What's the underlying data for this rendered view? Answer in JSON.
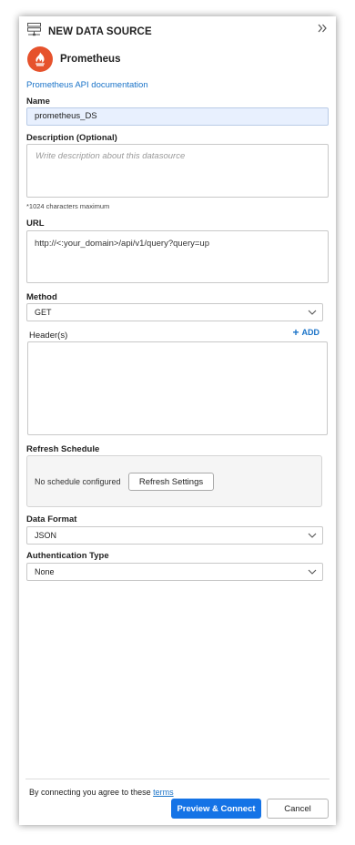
{
  "header": {
    "title": "NEW DATA SOURCE",
    "icon": "server-stack-icon",
    "collapse_icon": "double-chevron-right-icon"
  },
  "provider": {
    "name": "Prometheus",
    "logo_icon": "prometheus-flame-icon",
    "brand_color": "#e6522c"
  },
  "doc_link": "Prometheus API documentation",
  "fields": {
    "name": {
      "label": "Name",
      "value": "prometheus_DS"
    },
    "description": {
      "label": "Description (Optional)",
      "placeholder": "Write description about this datasource",
      "hint": "*1024 characters maximum"
    },
    "url": {
      "label": "URL",
      "value": "http://<:your_domain>/api/v1/query?query=up"
    },
    "method": {
      "label": "Method",
      "value": "GET"
    },
    "headers": {
      "label": "Header(s)",
      "add_label": "ADD"
    },
    "refresh": {
      "label": "Refresh Schedule",
      "status": "No schedule configured",
      "button": "Refresh Settings"
    },
    "data_format": {
      "label": "Data Format",
      "value": "JSON"
    },
    "auth": {
      "label": "Authentication Type",
      "value": "None"
    }
  },
  "footer": {
    "agree_text": "By connecting you agree to these",
    "terms_link": "terms",
    "primary_button": "Preview & Connect",
    "cancel_button": "Cancel"
  },
  "colors": {
    "accent": "#1473e6",
    "link": "#1a73c8",
    "name_field_bg": "#e8f0fe"
  }
}
